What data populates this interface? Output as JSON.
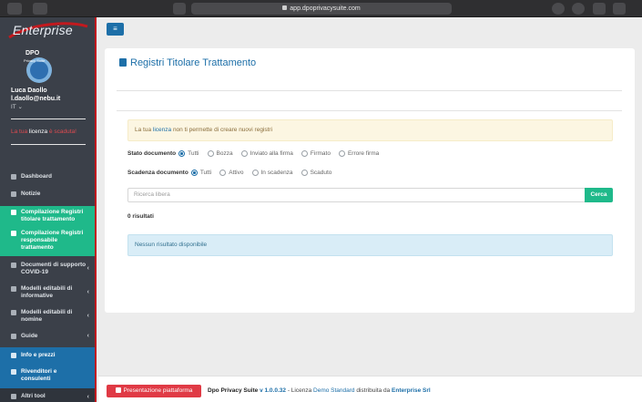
{
  "browser": {
    "url": "app.dpoprivacysuite.com"
  },
  "sidebar": {
    "brand": "Enterprise",
    "logo_text": "DPO",
    "logo_subtext": "Privacy Suite",
    "user_name": "Luca Daollo",
    "user_email": "l.daollo@nebu.it",
    "language": "IT ⌄",
    "license_prefix": "La tua",
    "license_word": "licenza",
    "license_suffix": "è scaduta!",
    "items": [
      {
        "label": "Dashboard",
        "icon": "dashboard-icon"
      },
      {
        "label": "Notizie",
        "icon": "news-icon"
      },
      {
        "label": "Compilazione Registri titolare trattamento",
        "icon": "book-icon"
      },
      {
        "label": "Compilazione Registri responsabile trattamento",
        "icon": "book-icon"
      },
      {
        "label": "Documenti di supporto COVID-19",
        "icon": "folder-icon"
      },
      {
        "label": "Modelli editabili di informative",
        "icon": "file-icon"
      },
      {
        "label": "Modelli editabili di nomine",
        "icon": "file-icon"
      },
      {
        "label": "Guide",
        "icon": "guide-icon"
      },
      {
        "label": "Info e prezzi",
        "icon": "info-icon"
      },
      {
        "label": "Rivenditori e consulenti",
        "icon": "users-icon"
      },
      {
        "label": "Altri tool",
        "icon": "tools-icon"
      }
    ]
  },
  "page": {
    "title": "Registri Titolare Trattamento",
    "warning_prefix": "La tua",
    "warning_link": "licenza",
    "warning_suffix": "non ti permette di creare nuovi registri",
    "stato_label": "Stato documento",
    "stato_options": [
      "Tutti",
      "Bozza",
      "Inviato alla firma",
      "Firmato",
      "Errore firma"
    ],
    "scadenza_label": "Scadenza documento",
    "scadenza_options": [
      "Tutti",
      "Attivo",
      "In scadenza",
      "Scaduto"
    ],
    "search_placeholder": "Ricerca libera",
    "search_button": "Cerca",
    "results_count": "0 risultati",
    "no_results": "Nessun risultato disponibile"
  },
  "footer": {
    "button": "Presentazione piattaforma",
    "product": "Dpo Privacy Suite",
    "version": "v 1.0.0.32",
    "license_text": "- Licenza",
    "license_type": "Demo Standard",
    "distributed": "distribuita da",
    "company": "Enterprise Srl"
  },
  "colors": {
    "primary": "#1d6fa8",
    "accent": "#1fb98a",
    "danger": "#e03a45",
    "sidebar": "#3b4049"
  }
}
